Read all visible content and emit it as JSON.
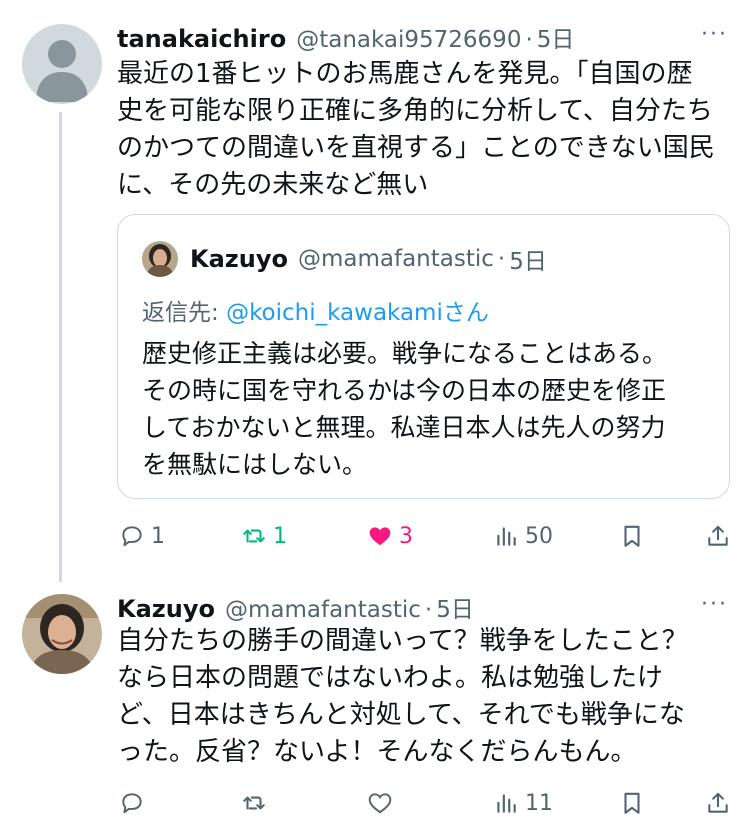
{
  "colors": {
    "retweet_active": "#00ba7c",
    "like_active": "#f91880",
    "link": "#1d9bf0",
    "muted": "#536471"
  },
  "tweet1": {
    "name": "tanakaichiro",
    "handle": "@tanakai95726690",
    "dot": "·",
    "time": "5日",
    "more": "···",
    "text": "最近の1番ヒットのお馬鹿さんを発見。「自国の歴\n史を可能な限り正確に多角的に分析して、自分たち\nのかつての間違いを直視する」ことのできない国民\nに、その先の未来など無い",
    "quote": {
      "name": "Kazuyo",
      "handle": "@mamafantastic",
      "dot": "·",
      "time": "5日",
      "reply_prefix": "返信先: ",
      "reply_mention": "@koichi_kawakami",
      "reply_suffix": "さん",
      "text": "歴史修正主義は必要。戦争になることはある。\nその時に国を守れるかは今の日本の歴史を修正\nしておかないと無理。私達日本人は先人の努力\nを無駄にはしない。"
    },
    "actions": {
      "replies": "1",
      "retweets": "1",
      "likes": "3",
      "views": "50"
    }
  },
  "tweet2": {
    "name": "Kazuyo",
    "handle": "@mamafantastic",
    "dot": "·",
    "time": "5日",
    "more": "···",
    "text": "自分たちの勝手の間違いって？戦争をしたこと？\nなら日本の問題ではないわよ。私は勉強したけ\nど、日本はきちんと対処して、それでも戦争にな\nった。反省？ないよ！そんなくだらんもん。",
    "actions": {
      "replies": "",
      "retweets": "",
      "likes": "",
      "views": "11"
    }
  }
}
